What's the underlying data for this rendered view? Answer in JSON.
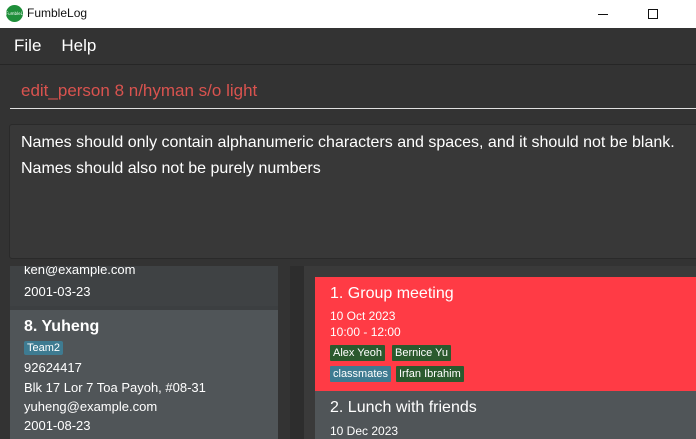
{
  "window": {
    "title": "FumbleLog",
    "icon_text": "FumbleLog"
  },
  "menu": {
    "file": "File",
    "help": "Help"
  },
  "command": {
    "value": "edit_person 8 n/hyman s/o light"
  },
  "result": {
    "line1": "Names should only contain alphanumeric characters and spaces, and it should not be blank.",
    "line2": "Names should also not be purely numbers"
  },
  "persons": {
    "previous": {
      "email": "ken@example.com",
      "birthday": "2001-03-23"
    },
    "card": {
      "name": "8.  Yuheng",
      "tag": "Team2",
      "phone": "92624417",
      "address": "Blk 17 Lor 7 Toa Payoh, #08-31",
      "email": "yuheng@example.com",
      "birthday": "2001-08-23"
    }
  },
  "events": [
    {
      "title": "1.  Group meeting",
      "date": "10 Oct 2023",
      "time": "10:00 - 12:00",
      "persons": [
        "Alex Yeoh",
        "Bernice Yu"
      ],
      "group": "classmates",
      "extra_person": "Irfan Ibrahim",
      "color": "#ff3b45"
    },
    {
      "title": "2.  Lunch with friends",
      "date": "10 Dec 2023"
    }
  ]
}
